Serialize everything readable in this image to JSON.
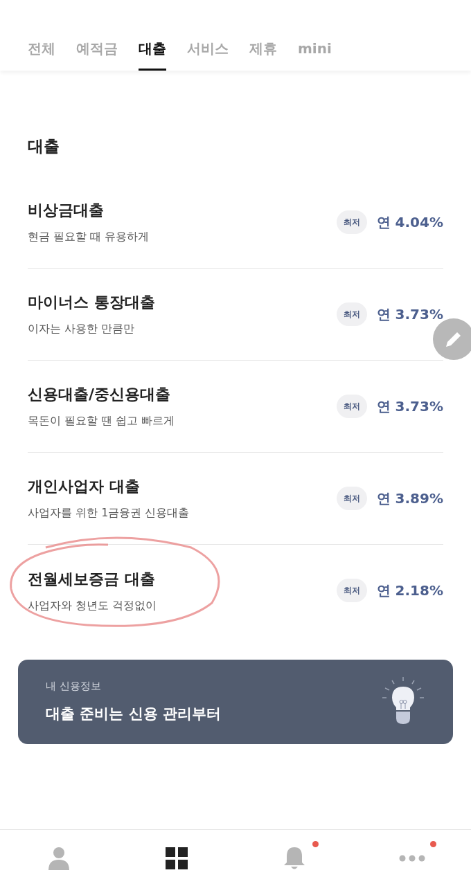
{
  "tabs": [
    {
      "label": "전체",
      "selected": false
    },
    {
      "label": "예적금",
      "selected": false
    },
    {
      "label": "대출",
      "selected": true
    },
    {
      "label": "서비스",
      "selected": false
    },
    {
      "label": "제휴",
      "selected": false
    },
    {
      "label": "mini",
      "selected": false
    }
  ],
  "section_title": "대출",
  "loans": [
    {
      "name": "비상금대출",
      "description": "현금 필요할 때 유용하게",
      "badge": "최저",
      "rate": "연 4.04%",
      "circled": false
    },
    {
      "name": "마이너스 통장대출",
      "description": "이자는 사용한 만큼만",
      "badge": "최저",
      "rate": "연 3.73%",
      "circled": false
    },
    {
      "name": "신용대출/중신용대출",
      "description": "목돈이 필요할 땐 쉽고 빠르게",
      "badge": "최저",
      "rate": "연 3.73%",
      "circled": false
    },
    {
      "name": "개인사업자 대출",
      "description": "사업자를 위한 1금융권 신용대출",
      "badge": "최저",
      "rate": "연 3.89%",
      "circled": false
    },
    {
      "name": "전월세보증금 대출",
      "description": "사업자와 청년도 걱정없이",
      "badge": "최저",
      "rate": "연 2.18%",
      "circled": true
    }
  ],
  "banner": {
    "subtitle": "내 신용정보",
    "title": "대출 준비는 신용 관리부터"
  },
  "nav": [
    {
      "kind": "profile",
      "selected": false,
      "badge": false
    },
    {
      "kind": "grid",
      "selected": true,
      "badge": false
    },
    {
      "kind": "bell",
      "selected": false,
      "badge": true
    },
    {
      "kind": "more",
      "selected": false,
      "badge": true
    }
  ]
}
